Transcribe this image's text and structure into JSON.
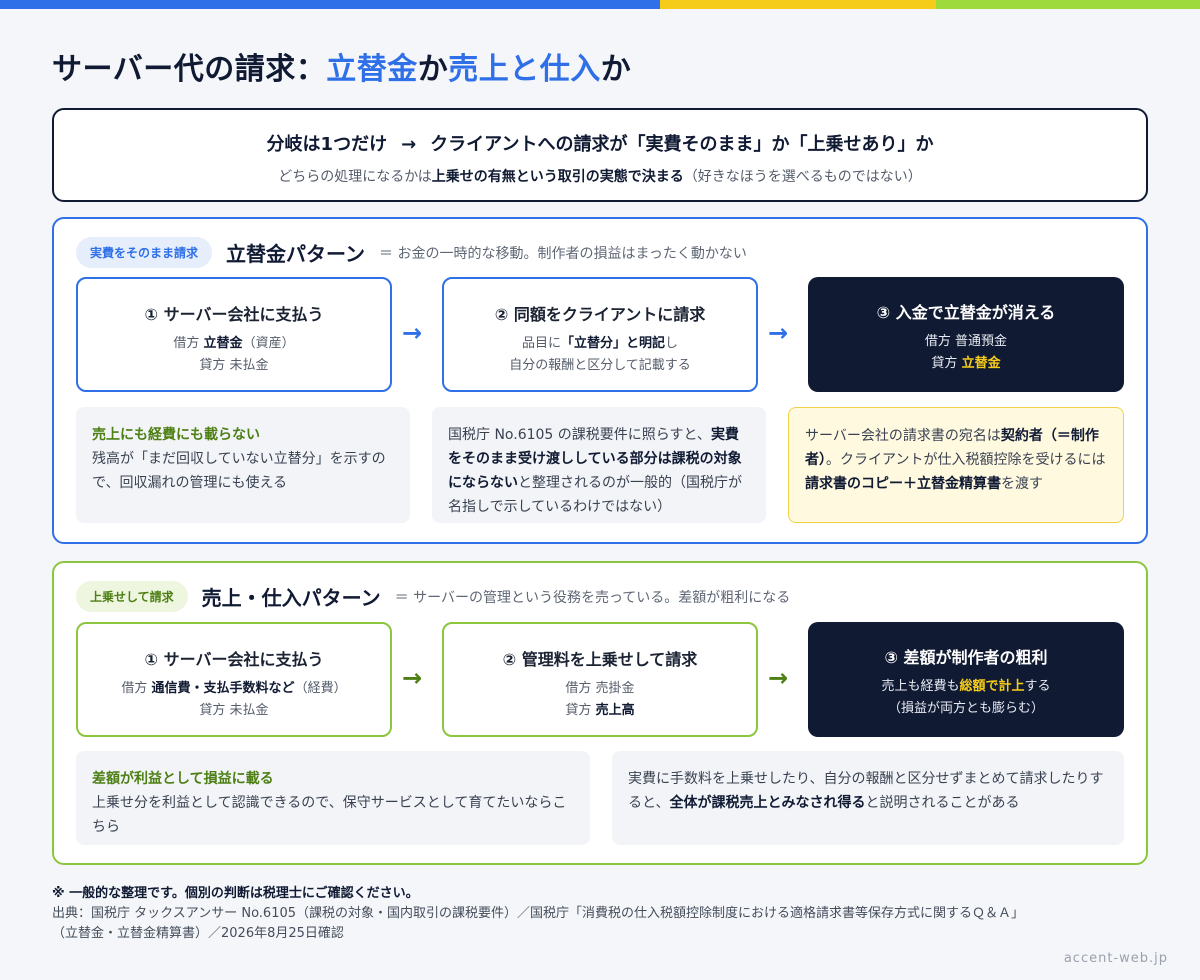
{
  "title": {
    "part1": "サーバー代の請求：",
    "part2": "立替金",
    "part3": "か",
    "part4": "売上と仕入",
    "part5": "か"
  },
  "summary": {
    "line1_left": "分岐は1つだけ",
    "arrow": "→",
    "line1_right": "クライアントへの請求が「実費そのまま」か「上乗せあり」か",
    "line2_pre": "どちらの処理になるかは",
    "line2_bold": "上乗せの有無という取引の実態で決まる",
    "line2_post": "（好きなほうを選べるものではない）"
  },
  "section_a": {
    "pill": "実費をそのまま請求",
    "title": "立替金パターン",
    "desc": "＝ お金の一時的な移動。制作者の損益はまったく動かない",
    "steps": [
      {
        "title": "① サーバー会社に支払う",
        "l1_pre": "借方 ",
        "l1_bold": "立替金",
        "l1_post": "（資産）",
        "l2_pre": "貸方 未払金",
        "l2_bold": "",
        "l2_post": ""
      },
      {
        "title": "② 同額をクライアントに請求",
        "l1_pre": "品目に",
        "l1_bold": "「立替分」と明記",
        "l1_post": "し",
        "l2_pre": "自分の報酬と区分して記載する",
        "l2_bold": "",
        "l2_post": ""
      },
      {
        "title": "③ 入金で立替金が消える",
        "l1_pre": "借方 普通預金",
        "l1_bold": "",
        "l1_post": "",
        "l2_pre": "貸方 ",
        "l2_bold": "立替金",
        "l2_post": ""
      }
    ],
    "arrow": "→",
    "notes": [
      {
        "head": "売上にも経費にも載らない",
        "body": "残高が「まだ回収していない立替分」を示すので、回収漏れの管理にも使える"
      },
      {
        "pre": "国税庁 No.6105 の課税要件に照らすと、",
        "bold": "実費をそのまま受け渡ししている部分は課税の対象にならない",
        "post": "と整理されるのが一般的（国税庁が名指しで示しているわけではない）"
      },
      {
        "pre": "サーバー会社の請求書の宛名は",
        "bold1": "契約者（＝制作者）",
        "mid": "。クライアントが仕入税額控除を受けるには",
        "bold2": "請求書のコピー＋立替金精算書",
        "post": "を渡す"
      }
    ]
  },
  "section_b": {
    "pill": "上乗せして請求",
    "title": "売上・仕入パターン",
    "desc": "＝ サーバーの管理という役務を売っている。差額が粗利になる",
    "steps": [
      {
        "title": "① サーバー会社に支払う",
        "l1_pre": "借方 ",
        "l1_bold": "通信費・支払手数料など",
        "l1_post": "（経費）",
        "l2_pre": "貸方 未払金",
        "l2_bold": "",
        "l2_post": ""
      },
      {
        "title": "② 管理料を上乗せして請求",
        "l1_pre": "借方 売掛金",
        "l1_bold": "",
        "l1_post": "",
        "l2_pre": "貸方 ",
        "l2_bold": "売上高",
        "l2_post": ""
      },
      {
        "title": "③ 差額が制作者の粗利",
        "l1_pre": "売上も経費も",
        "l1_bold": "総額で計上",
        "l1_post": "する",
        "l2_pre": "（損益が両方とも膨らむ）",
        "l2_bold": "",
        "l2_post": ""
      }
    ],
    "arrow": "→",
    "notes": [
      {
        "head": "差額が利益として損益に載る",
        "body": "上乗せ分を利益として認識できるので、保守サービスとして育てたいならこちら"
      },
      {
        "pre": "実費に手数料を上乗せしたり、自分の報酬と区分せずまとめて請求したりすると、",
        "bold": "全体が課税売上とみなされ得る",
        "post": "と説明されることがある"
      }
    ]
  },
  "footer": {
    "note": "※ 一般的な整理です。個別の判断は税理士にご確認ください。",
    "source1": "出典：国税庁 タックスアンサー No.6105（課税の対象・国内取引の課税要件）／国税庁「消費税の仕入税額控除制度における適格請求書等保存方式に関するＱ＆Ａ」",
    "source2": "（立替金・立替金精算書）／2026年8月25日確認"
  },
  "domain": "accent-web.jp",
  "colors": {
    "blue": "#2f6fe8",
    "green": "#8cc63f",
    "navy": "#101a33",
    "yellow": "#f6cc1a"
  }
}
